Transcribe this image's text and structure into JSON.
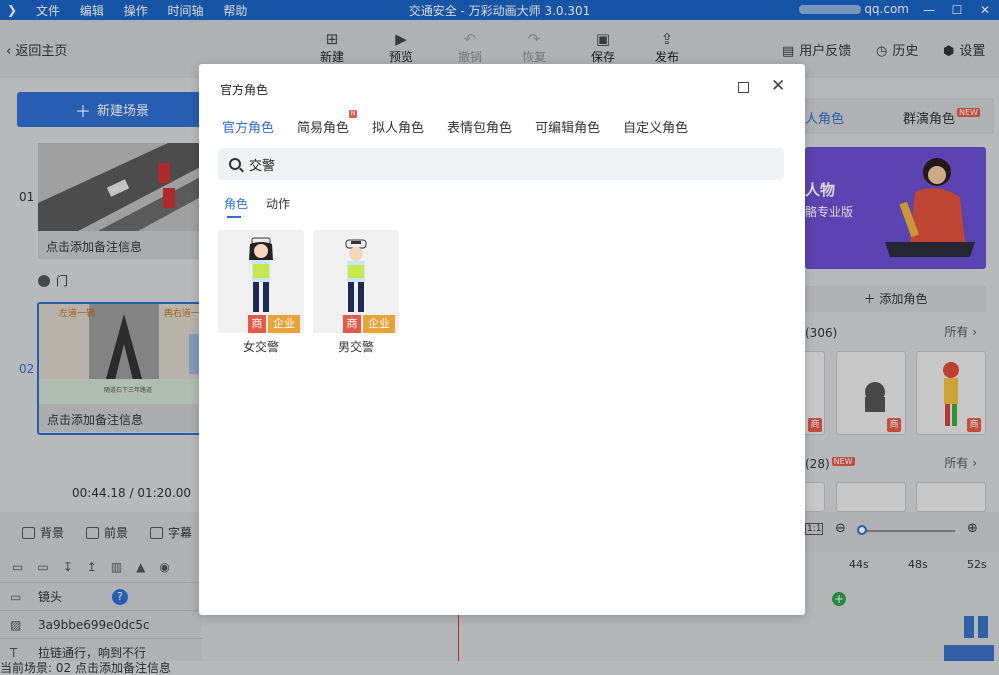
{
  "titlebar": {
    "menu": [
      "文件",
      "编辑",
      "操作",
      "时间轴",
      "帮助"
    ],
    "title": "交通安全 - 万彩动画大师 3.0.301",
    "account": "qq.com"
  },
  "toolbar": {
    "back": "返回主页",
    "new": "新建",
    "preview": "预览",
    "undo": "撤销",
    "redo": "恢复",
    "save": "保存",
    "publish": "发布",
    "feedback": "用户反馈",
    "history": "历史",
    "settings": "设置"
  },
  "left": {
    "new_scene": "新建场景",
    "scenes": [
      {
        "num": "01",
        "note": "点击添加备注信息"
      },
      {
        "num": "02",
        "note": "点击添加备注信息",
        "lane_left": "左道一辆",
        "lane_right": "再右道一",
        "caption": "随道石下三年路道"
      }
    ],
    "transition": "门",
    "time_current": "00:44.18",
    "time_total": "/ 01:20.00"
  },
  "bottom": {
    "bg": "背景",
    "fg": "前景",
    "subtitle": "字幕",
    "layers": [
      {
        "label": "镜头"
      },
      {
        "label": "3a9bbe699e0dc5c"
      },
      {
        "label": "拉链通行，响到不行"
      }
    ],
    "status": "当前场景: 02    点击添加备注信息",
    "ticks": [
      "44s",
      "48s",
      "52s"
    ]
  },
  "right": {
    "tab_person": "人角色",
    "tab_crowd": "群演角色",
    "new_badge": "NEW",
    "banner_line1": "人物",
    "banner_line2": "骼专业版",
    "add_role": "添加角色",
    "sect1_count": "(306)",
    "sect2_count": "(28)",
    "more": "所有",
    "shang": "商"
  },
  "modal": {
    "title": "官方角色",
    "tabs": [
      "官方角色",
      "简易角色",
      "拟人角色",
      "表情包角色",
      "可编辑角色",
      "自定义角色"
    ],
    "tab_badge": "N",
    "search_value": "交警",
    "subtabs": [
      "角色",
      "动作"
    ],
    "cards": [
      {
        "name": "女交警",
        "tag1": "商",
        "tag2": "企业"
      },
      {
        "name": "男交警",
        "tag1": "商",
        "tag2": "企业"
      }
    ]
  }
}
